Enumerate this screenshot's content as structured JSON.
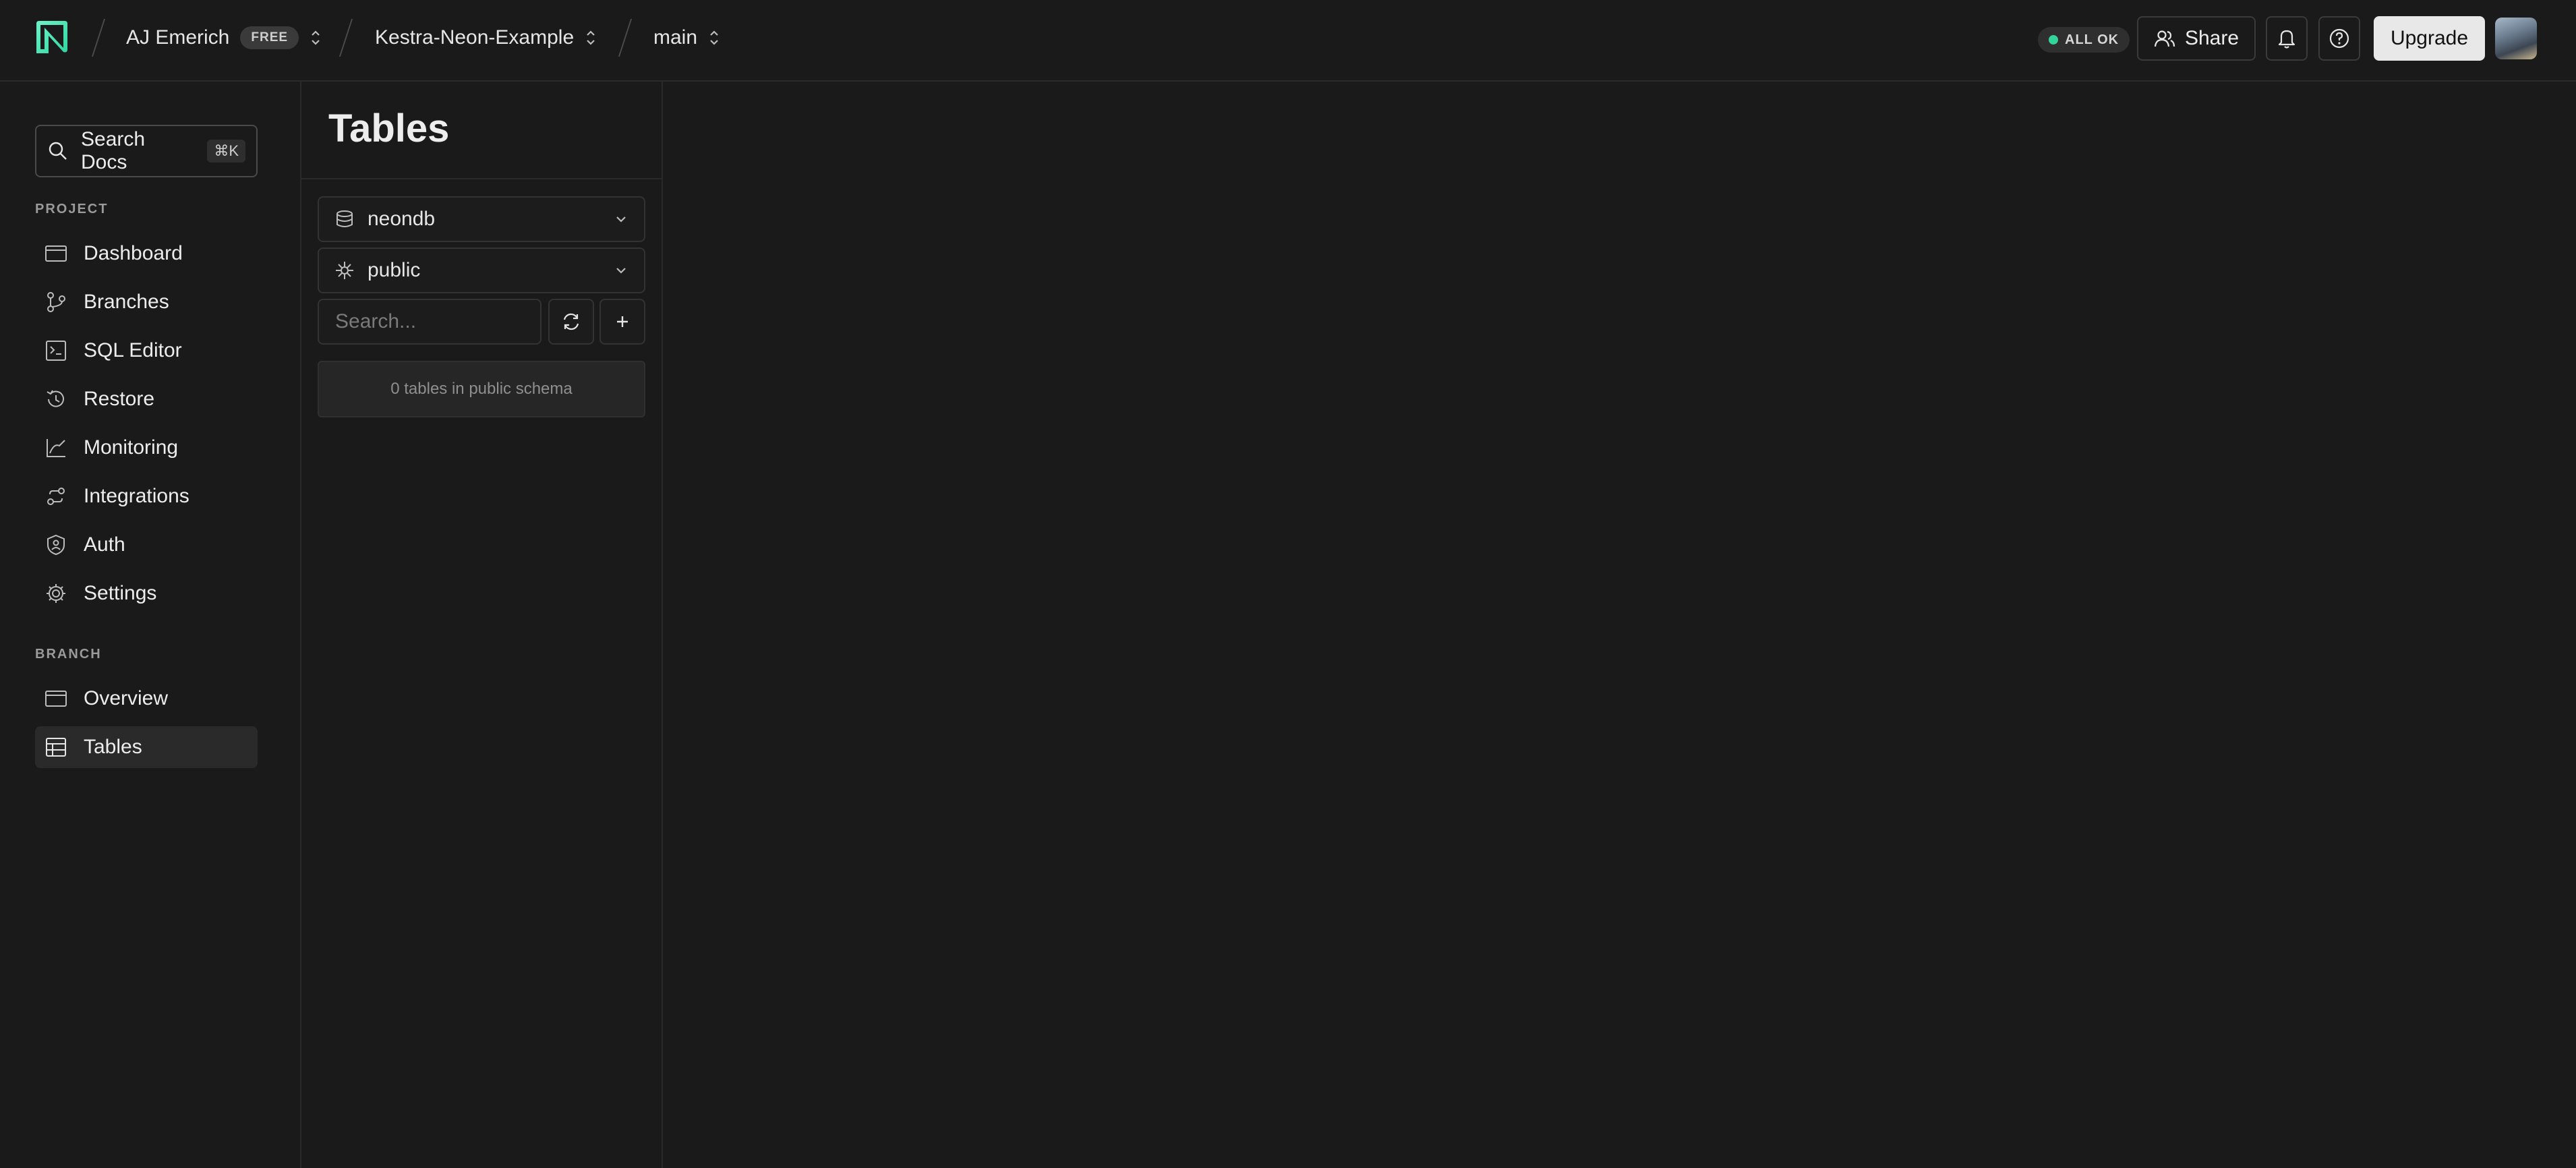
{
  "header": {
    "org": {
      "name": "AJ Emerich",
      "plan_badge": "FREE"
    },
    "project": {
      "name": "Kestra-Neon-Example"
    },
    "branch": {
      "name": "main"
    },
    "status": "ALL OK",
    "share_label": "Share",
    "upgrade_label": "Upgrade"
  },
  "sidebar": {
    "search": {
      "label": "Search Docs",
      "shortcut": "⌘K"
    },
    "project_section": "PROJECT",
    "project_items": [
      {
        "label": "Dashboard",
        "icon": "dashboard-icon"
      },
      {
        "label": "Branches",
        "icon": "branches-icon"
      },
      {
        "label": "SQL Editor",
        "icon": "sql-editor-icon"
      },
      {
        "label": "Restore",
        "icon": "restore-icon"
      },
      {
        "label": "Monitoring",
        "icon": "monitoring-icon"
      },
      {
        "label": "Integrations",
        "icon": "integrations-icon"
      },
      {
        "label": "Auth",
        "icon": "auth-icon"
      },
      {
        "label": "Settings",
        "icon": "settings-icon"
      }
    ],
    "branch_section": "BRANCH",
    "branch_items": [
      {
        "label": "Overview",
        "icon": "overview-icon"
      },
      {
        "label": "Tables",
        "icon": "tables-icon",
        "active": true
      }
    ]
  },
  "tables_panel": {
    "title": "Tables",
    "database": "neondb",
    "schema": "public",
    "search_placeholder": "Search...",
    "empty_message": "0 tables in public schema"
  },
  "colors": {
    "accent": "#34d399",
    "background": "#1a1a1a",
    "border": "#2a2a2a"
  }
}
